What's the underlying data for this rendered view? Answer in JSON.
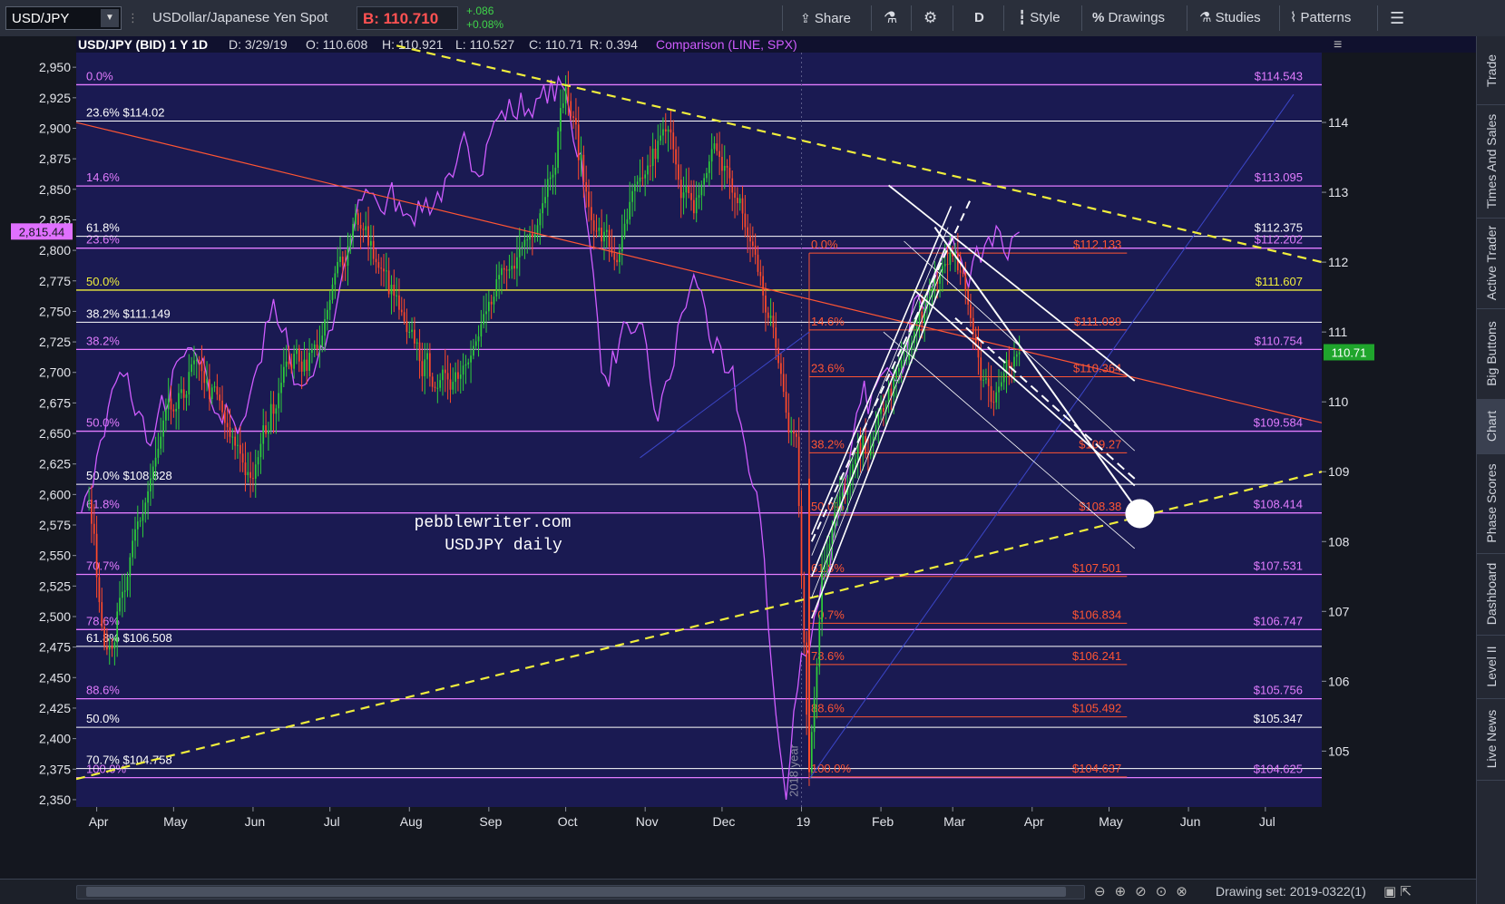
{
  "toolbar": {
    "symbol": "USD/JPY",
    "description": "USDollar/Japanese Yen Spot",
    "bid": "B: 110.710",
    "change_abs": "+.086",
    "change_pct": "+0.08%",
    "share": "Share",
    "timeframe": "D",
    "style": "Style",
    "drawings": "Drawings",
    "studies": "Studies",
    "patterns": "Patterns"
  },
  "side_tabs": [
    "Trade",
    "Times And Sales",
    "Active Trader",
    "Big Buttons",
    "Chart",
    "Phase Scores",
    "Dashboard",
    "Level II",
    "Live News"
  ],
  "status": {
    "drawing_set": "Drawing set: 2019-0322(1)"
  },
  "colors": {
    "plot_bg": "#1a1a52",
    "up": "#2ecf3a",
    "down": "#ff4a2a",
    "spx": "#cf5cff",
    "fib_pink": "#e27cff",
    "fib_red": "#ff5533",
    "trend_yellow": "#f0ee3c",
    "white": "#ffffff",
    "current_price": "#1fa52c"
  },
  "chart_data": {
    "type": "candlestick",
    "header": {
      "title": "USD/JPY (BID) 1 Y 1D",
      "date": "D: 3/29/19",
      "open": "O: 110.608",
      "high": "H: 110.921",
      "low": "L: 110.527",
      "close": "C: 110.71",
      "range": "R: 0.394",
      "comparison": "Comparison (LINE, SPX)"
    },
    "watermark": [
      "pebblewriter.com",
      "USDJPY daily"
    ],
    "vertical_label": "2018 year",
    "x_labels": [
      {
        "label": "Apr",
        "day": 3
      },
      {
        "label": "May",
        "day": 33
      },
      {
        "label": "Jun",
        "day": 64
      },
      {
        "label": "Jul",
        "day": 94
      },
      {
        "label": "Aug",
        "day": 125
      },
      {
        "label": "Sep",
        "day": 156
      },
      {
        "label": "Oct",
        "day": 186
      },
      {
        "label": "Nov",
        "day": 217
      },
      {
        "label": "Dec",
        "day": 247
      },
      {
        "label": "19",
        "day": 278
      },
      {
        "label": "Feb",
        "day": 309
      },
      {
        "label": "Mar",
        "day": 337
      },
      {
        "label": "Apr",
        "day": 368
      },
      {
        "label": "May",
        "day": 398
      },
      {
        "label": "Jun",
        "day": 429
      },
      {
        "label": "Jul",
        "day": 459
      }
    ],
    "x_range": [
      -5,
      481
    ],
    "y_right": {
      "ticks": [
        105,
        106,
        107,
        108,
        109,
        110,
        111,
        112,
        113,
        114
      ],
      "range": [
        104.2,
        115.0
      ]
    },
    "y_left": {
      "ticks": [
        2350,
        2375,
        2400,
        2425,
        2450,
        2475,
        2500,
        2525,
        2550,
        2575,
        2600,
        2625,
        2650,
        2675,
        2700,
        2725,
        2750,
        2775,
        2800,
        2825,
        2850,
        2875,
        2900,
        2925,
        2950
      ],
      "tick_labels": [
        "2,350",
        "2,375",
        "2,400",
        "2,425",
        "2,450",
        "2,475",
        "2,500",
        "2,525",
        "2,550",
        "2,575",
        "2,600",
        "2,625",
        "2,650",
        "2,675",
        "2,700",
        "2,725",
        "2,750",
        "2,775",
        "2,800",
        "2,825",
        "2,850",
        "2,875",
        "2,900",
        "2,925",
        "2,950"
      ],
      "range": [
        2344,
        2962
      ]
    },
    "spx_last": {
      "value": 2815.44,
      "label": "2,815.44"
    },
    "last_price": {
      "value": 110.71,
      "label": "110.71"
    },
    "fib_left_pink": [
      {
        "label": "0.0%",
        "price": 114.54
      },
      {
        "label": "14.6%",
        "price": 113.09
      },
      {
        "label": "23.6%",
        "price": 112.2
      },
      {
        "label": "38.2%",
        "price": 110.75
      },
      {
        "label": "50.0%",
        "price": 109.58
      },
      {
        "label": "61.8%",
        "price": 108.41
      },
      {
        "label": "70.7%",
        "price": 107.53
      },
      {
        "label": "78.6%",
        "price": 106.74
      },
      {
        "label": "88.6%",
        "price": 105.75
      },
      {
        "label": "100.0%",
        "price": 104.62
      }
    ],
    "fib_left_white": [
      {
        "label": "23.6%   $114.02",
        "price": 114.02
      },
      {
        "label": "61.8%",
        "price": 112.37
      },
      {
        "label": "38.2%   $111.149",
        "price": 111.14
      },
      {
        "label": "50.0%   $108.828",
        "price": 108.82
      },
      {
        "label": "61.8%   $106.508",
        "price": 106.5
      },
      {
        "label": "50.0%",
        "price": 105.34
      },
      {
        "label": "70.7%   $104.758",
        "price": 104.75
      }
    ],
    "fib_yellow": {
      "label": "50.0%",
      "price": 111.6,
      "right_label": "$111.607"
    },
    "right_labels": [
      {
        "text": "$114.543",
        "price": 114.54,
        "color": "pink"
      },
      {
        "text": "$113.095",
        "price": 113.09,
        "color": "pink"
      },
      {
        "text": "$112.375",
        "price": 112.37,
        "color": "white"
      },
      {
        "text": "$112.202",
        "price": 112.2,
        "color": "pink"
      },
      {
        "text": "$110.754",
        "price": 110.75,
        "color": "pink"
      },
      {
        "text": "$109.584",
        "price": 109.58,
        "color": "pink"
      },
      {
        "text": "$108.414",
        "price": 108.41,
        "color": "pink"
      },
      {
        "text": "$107.531",
        "price": 107.53,
        "color": "pink"
      },
      {
        "text": "$106.747",
        "price": 106.74,
        "color": "pink"
      },
      {
        "text": "$105.756",
        "price": 105.75,
        "color": "pink"
      },
      {
        "text": "$105.347",
        "price": 105.34,
        "color": "white"
      },
      {
        "text": "$104.625",
        "price": 104.62,
        "color": "pink"
      }
    ],
    "fib_red": [
      {
        "label": "0.0%",
        "price": 112.13,
        "right": "$112.133"
      },
      {
        "label": "14.6%",
        "price": 111.03,
        "right": "$111.039"
      },
      {
        "label": "23.6%",
        "price": 110.36,
        "right": "$110.364"
      },
      {
        "label": "38.2%",
        "price": 109.27,
        "right": "$109.27"
      },
      {
        "label": "50.0%",
        "price": 108.38,
        "right": "$108.38"
      },
      {
        "label": "61.8%",
        "price": 107.5,
        "right": "$107.501"
      },
      {
        "label": "70.7%",
        "price": 106.83,
        "right": "$106.834"
      },
      {
        "label": "78.6%",
        "price": 106.24,
        "right": "$106.241"
      },
      {
        "label": "88.6%",
        "price": 105.49,
        "right": "$105.492"
      },
      {
        "label": "100.0%",
        "price": 104.63,
        "right": "$104.637"
      }
    ],
    "anchors": {
      "candles_start": [
        0,
        108.6
      ],
      "sep_high": [
        186,
        114.5
      ],
      "jan_low": [
        281,
        104.7
      ],
      "mar_high": [
        336,
        112.13
      ],
      "last": [
        363,
        110.71
      ]
    },
    "trendlines": {
      "yellow_upper": [
        [
          120,
          115.1
        ],
        [
          481,
          112.0
        ]
      ],
      "yellow_lower": [
        [
          -5,
          104.6
        ],
        [
          481,
          109.0
        ]
      ],
      "red_diagonal": [
        [
          -5,
          114.0
        ],
        [
          481,
          109.7
        ]
      ],
      "blue": [
        [
          281,
          104.6
        ],
        [
          470,
          114.4
        ]
      ],
      "blue2": [
        [
          215,
          109.2
        ],
        [
          281,
          111.0
        ]
      ]
    },
    "channel_up": {
      "base": [
        [
          282,
          107.5
        ],
        [
          334,
          112.2
        ]
      ],
      "offsets": [
        -0.6,
        -0.3,
        0.3,
        0.6
      ],
      "dashed": [
        [
          282,
          108.0
        ],
        [
          344,
          112.9
        ]
      ]
    },
    "channel_down": {
      "main": [
        [
          330,
          112.5
        ],
        [
          410,
          108.4
        ]
      ],
      "others": [
        [
          [
            312,
            113.1
          ],
          [
            408,
            110.3
          ]
        ],
        [
          [
            318,
            112.3
          ],
          [
            408,
            109.3
          ]
        ],
        [
          [
            322,
            111.6
          ],
          [
            408,
            108.8
          ]
        ],
        [
          [
            310,
            111.0
          ],
          [
            408,
            107.9
          ]
        ]
      ],
      "dashed": [
        [
          338,
          111.2
        ],
        [
          408,
          108.9
        ]
      ]
    },
    "target_circle": [
      410,
      108.4
    ]
  }
}
